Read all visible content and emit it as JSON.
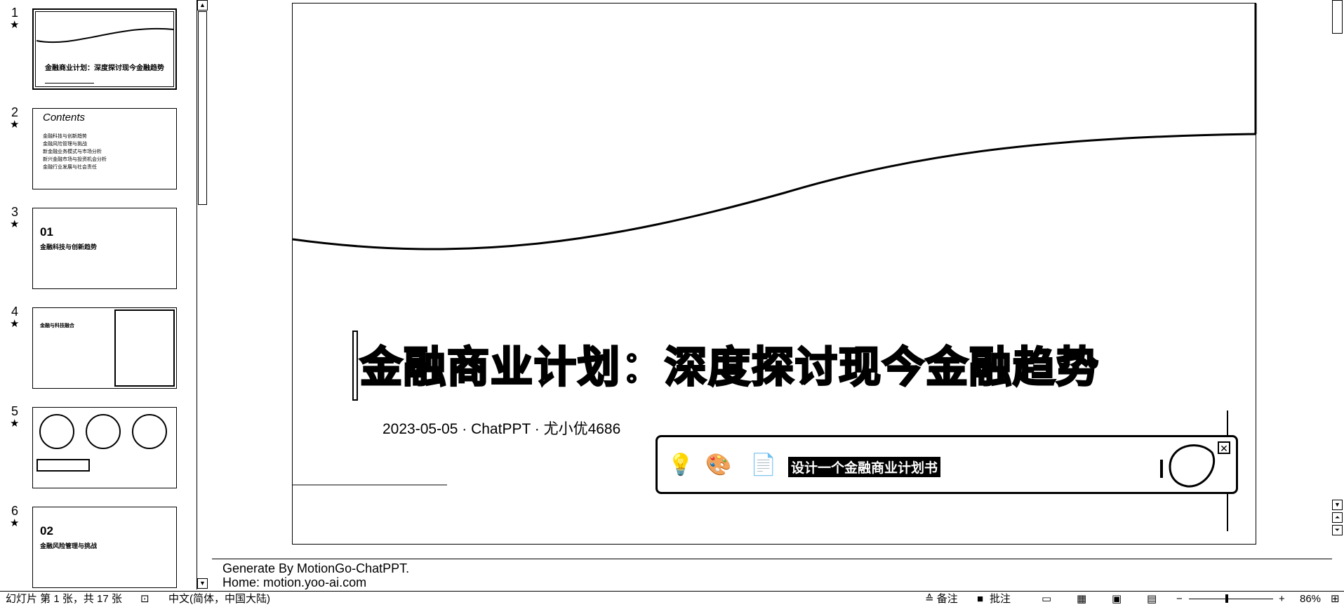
{
  "thumbnails": {
    "slides": [
      {
        "num": "1",
        "star": "★",
        "title": "金融商业计划：深度探讨现今金融趋势"
      },
      {
        "num": "2",
        "star": "★",
        "heading": "Contents",
        "items": [
          "金融科技与创新趋势",
          "金融风险管理与挑战",
          "新金融业务模式与市场分析",
          "新兴金融市场与投资机会分析",
          "金融行业发展与社会责任"
        ]
      },
      {
        "num": "3",
        "star": "★",
        "big": "01",
        "sub": "金融科技与创新趋势"
      },
      {
        "num": "4",
        "star": "★",
        "sub": "金融与科技融合"
      },
      {
        "num": "5",
        "star": "★"
      },
      {
        "num": "6",
        "star": "★",
        "big": "02",
        "sub": "金融风险管理与挑战"
      }
    ]
  },
  "slide": {
    "title": "金融商业计划：深度探讨现今金融趋势",
    "subtitle": "2023-05-05 · ChatPPT · 尤小优4686"
  },
  "assistant": {
    "prompt": "设计一个金融商业计划书",
    "icons": [
      "lightbulb-icon",
      "palette-icon",
      "document-icon"
    ],
    "close": "✕"
  },
  "notes": {
    "line1": "Generate By MotionGo-ChatPPT.",
    "line2": "Home:  motion.yoo-ai.com"
  },
  "status": {
    "slide_info": "幻灯片 第 1 张，共 17 张",
    "language": "中文(简体，中国大陆)",
    "notes_btn": "≙ 备注",
    "comments_btn": "批注",
    "zoom_minus": "−",
    "zoom_plus": "+",
    "zoom_level": "86%",
    "zoom_fraction": 0.45
  }
}
